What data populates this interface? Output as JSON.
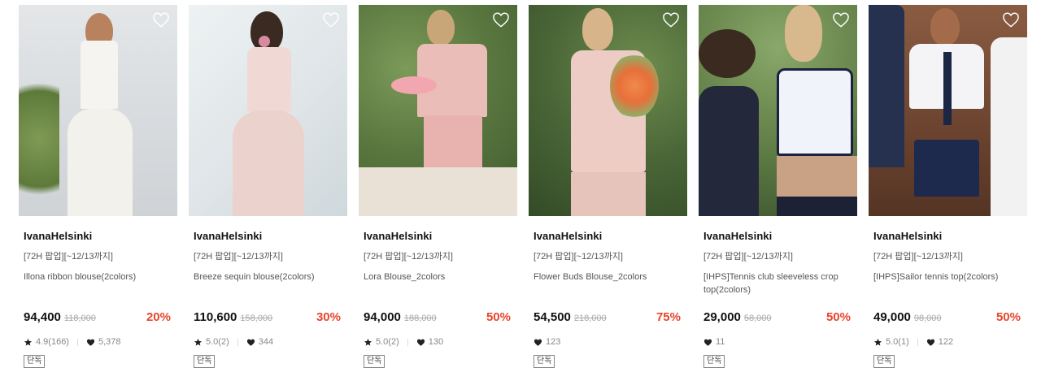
{
  "products": [
    {
      "brand": "IvanaHelsinki",
      "promo": "[72H 팝업][~12/13까지]",
      "name": "Illona ribbon blouse(2colors)",
      "price": "94,400",
      "original_price": "118,000",
      "discount": "20%",
      "rating": "4.9(166)",
      "likes": "5,378",
      "badge": "단독",
      "image_colors": {
        "bg": "#d9dde0",
        "figure": "#f4f2ee"
      }
    },
    {
      "brand": "IvanaHelsinki",
      "promo": "[72H 팝업][~12/13까지]",
      "name": "Breeze sequin blouse(2colors)",
      "price": "110,600",
      "original_price": "158,000",
      "discount": "30%",
      "rating": "5.0(2)",
      "likes": "344",
      "badge": "단독",
      "image_colors": {
        "bg": "#e3e8ea",
        "figure": "#efd6d2"
      }
    },
    {
      "brand": "IvanaHelsinki",
      "promo": "[72H 팝업][~12/13까지]",
      "name": "Lora Blouse_2colors",
      "price": "94,000",
      "original_price": "188,000",
      "discount": "50%",
      "rating": "5.0(2)",
      "likes": "130",
      "badge": "단독",
      "image_colors": {
        "bg": "#5f7a44",
        "figure": "#eab9b6"
      }
    },
    {
      "brand": "IvanaHelsinki",
      "promo": "[72H 팝업][~12/13까지]",
      "name": "Flower Buds Blouse_2colors",
      "price": "54,500",
      "original_price": "218,000",
      "discount": "75%",
      "rating": "",
      "likes": "123",
      "badge": "단독",
      "image_colors": {
        "bg": "#4f6a3c",
        "figure": "#e9c6bf"
      }
    },
    {
      "brand": "IvanaHelsinki",
      "promo": "[72H 팝업][~12/13까지]",
      "name": "[IHPS]Tennis club sleeveless crop top(2colors)",
      "price": "29,000",
      "original_price": "58,000",
      "discount": "50%",
      "rating": "",
      "likes": "11",
      "badge": "단독",
      "image_colors": {
        "bg": "#6d8a52",
        "figure": "#eef0f7"
      }
    },
    {
      "brand": "IvanaHelsinki",
      "promo": "[72H 팝업][~12/13까지]",
      "name": "[IHPS]Sailor tennis top(2colors)",
      "price": "49,000",
      "original_price": "98,000",
      "discount": "50%",
      "rating": "5.0(1)",
      "likes": "122",
      "badge": "단독",
      "image_colors": {
        "bg": "#7a5038",
        "figure": "#f2f2f2"
      }
    }
  ],
  "icons": {
    "wishlist": "heart-outline-icon",
    "rating": "star-icon",
    "likes": "heart-filled-icon"
  },
  "colors": {
    "discount": "#e8452c",
    "text": "#111111",
    "muted": "#888888"
  }
}
